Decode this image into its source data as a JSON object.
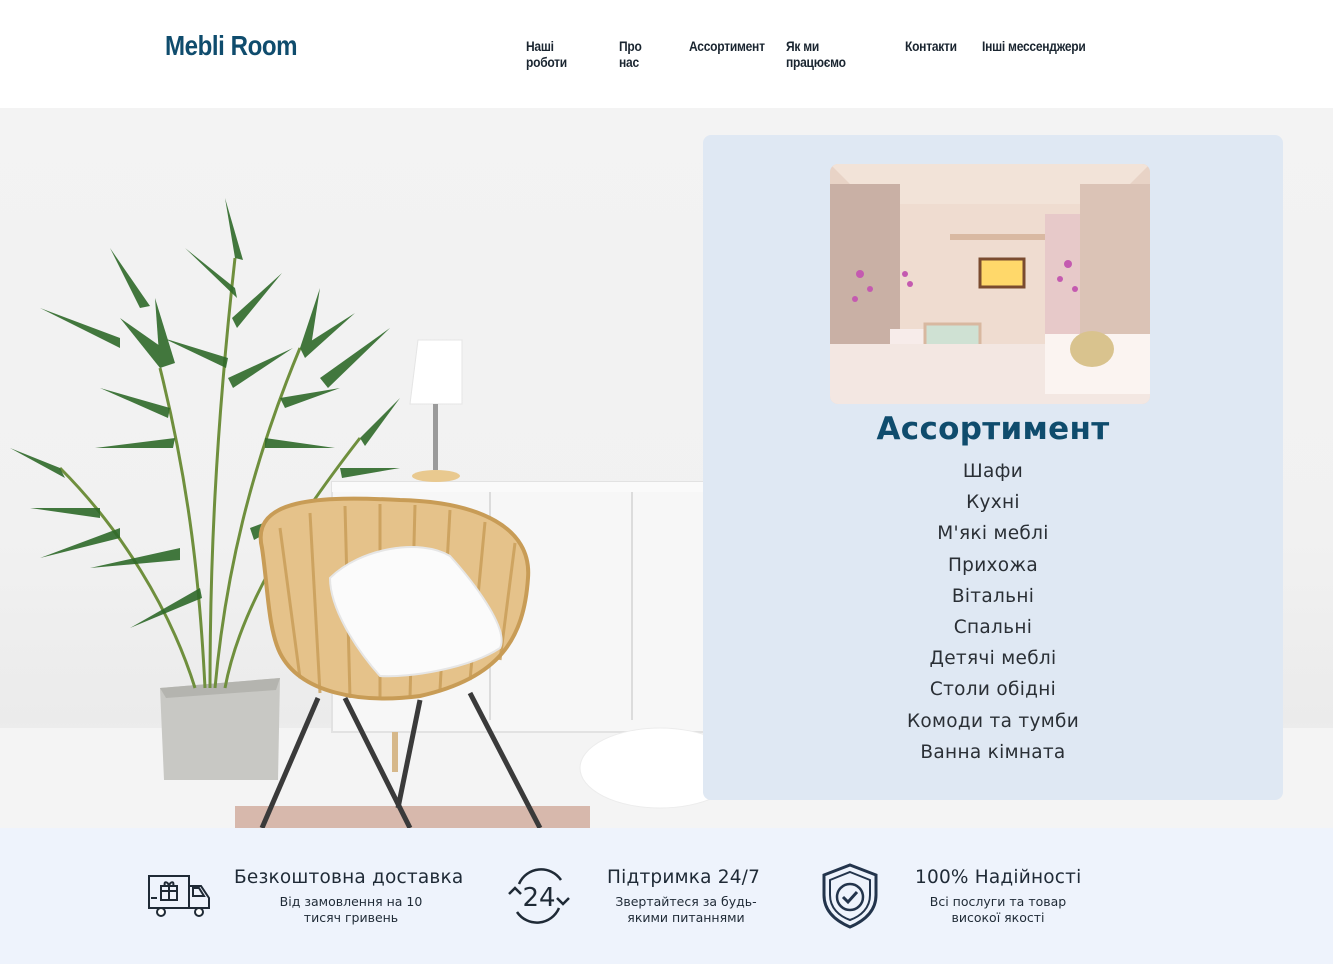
{
  "header": {
    "logo": "Mebli Room",
    "nav": [
      "Наші роботи",
      "Про нас",
      "Ассортимент",
      "Як ми працюємо",
      "Контакти",
      "Інші мессенджери"
    ]
  },
  "assortment": {
    "title": "Ассортимент",
    "items": [
      "Шафи",
      "Кухні",
      "М'які меблі",
      "Прихожа",
      "Вітальні",
      "Спальні",
      "Детячі меблі",
      "Столи обідні",
      "Комоди та тумби",
      "Ванна кімната"
    ]
  },
  "features": [
    {
      "icon": "delivery-truck-icon",
      "title": "Безкоштовна доставка",
      "desc_line1": "Від замовлення на 10",
      "desc_line2": "тисяч гривень"
    },
    {
      "icon": "support-24-icon",
      "title": "Підтримка 24/7",
      "desc_line1": "Звертайтеся за будь-",
      "desc_line2": "якими питаннями"
    },
    {
      "icon": "shield-check-icon",
      "title": "100% Надійності",
      "desc_line1": "Всі послуги та товар",
      "desc_line2": "високої якості"
    }
  ],
  "colors": {
    "brand": "#0f4c6d",
    "panel_bg": "#dfe8f3",
    "features_bg": "#eef3fc"
  }
}
